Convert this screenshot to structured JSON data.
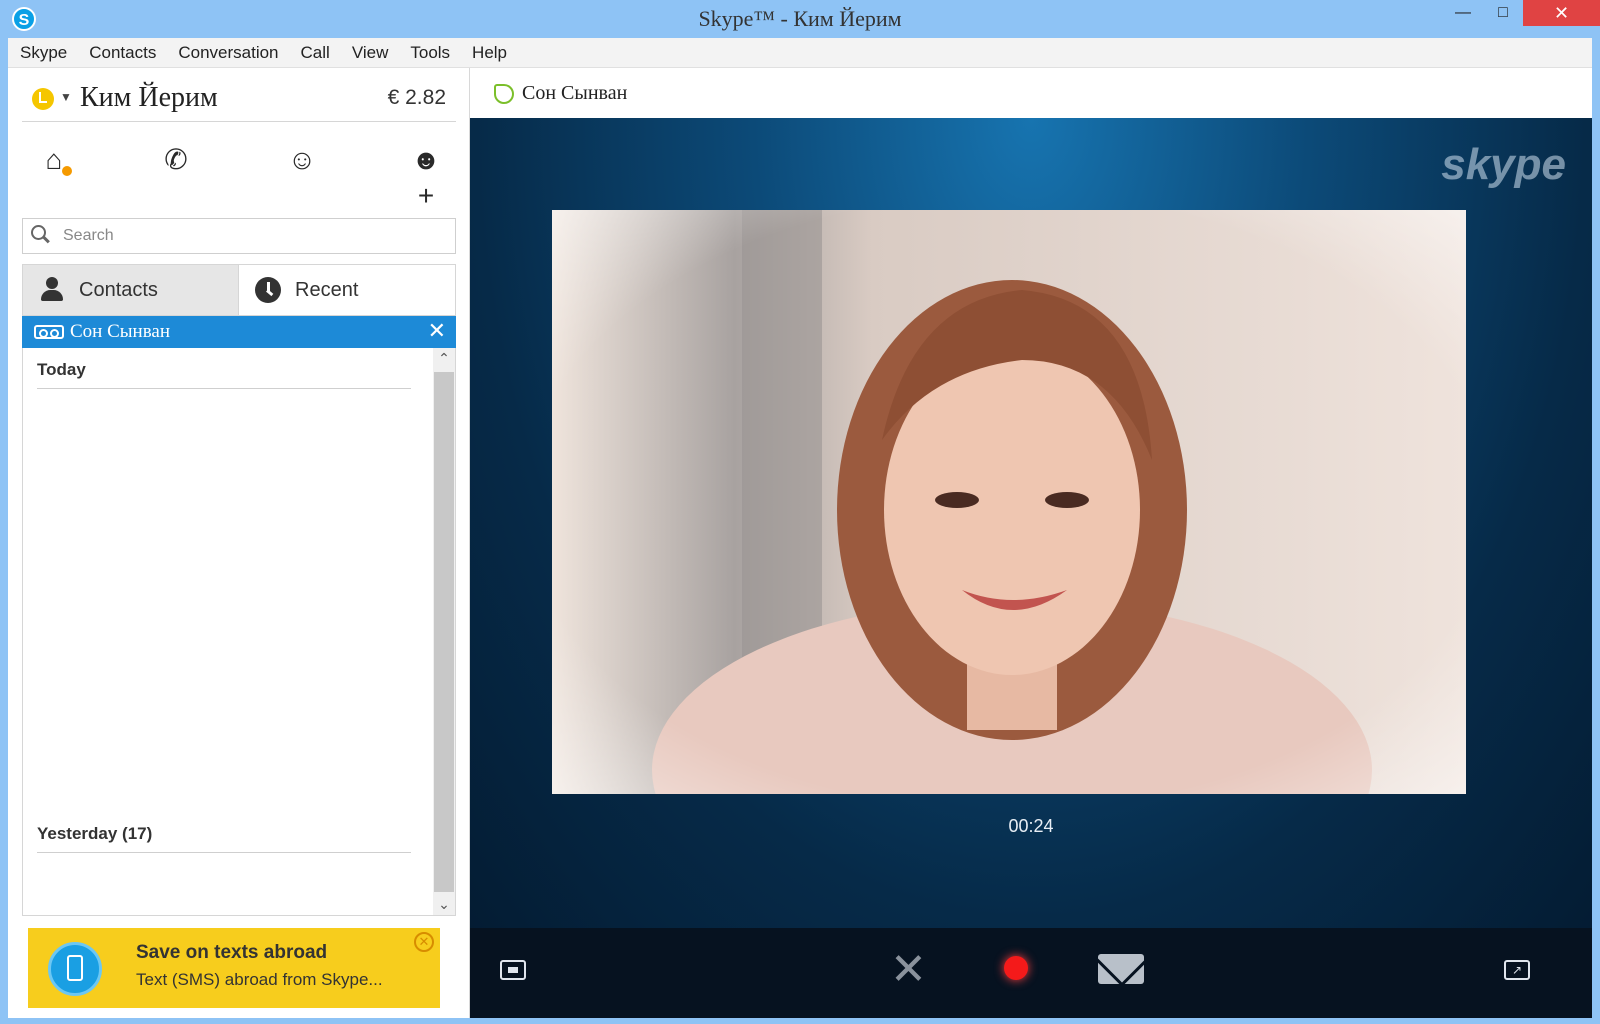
{
  "window": {
    "title": "Skype™ -  Ким Йерим"
  },
  "menu": [
    "Skype",
    "Contacts",
    "Conversation",
    "Call",
    "View",
    "Tools",
    "Help"
  ],
  "profile": {
    "name": "Ким Йерим",
    "credit": "€ 2.82"
  },
  "search": {
    "placeholder": "Search"
  },
  "tabs": {
    "contacts": "Contacts",
    "recent": "Recent"
  },
  "active_call": {
    "name": "Сон Сынван"
  },
  "history": {
    "today": "Today",
    "yesterday": "Yesterday (17)"
  },
  "promo": {
    "title": "Save on texts abroad",
    "text": "Text (SMS) abroad from Skype..."
  },
  "conversation": {
    "name": "Сон Сынван",
    "timer": "00:24",
    "watermark": "skype"
  },
  "colors": {
    "accent": "#1d8ad7",
    "promo": "#f7cd1d",
    "record": "#f41a1a",
    "status_online": "#7bbf2a",
    "status_away": "#f5c600"
  }
}
